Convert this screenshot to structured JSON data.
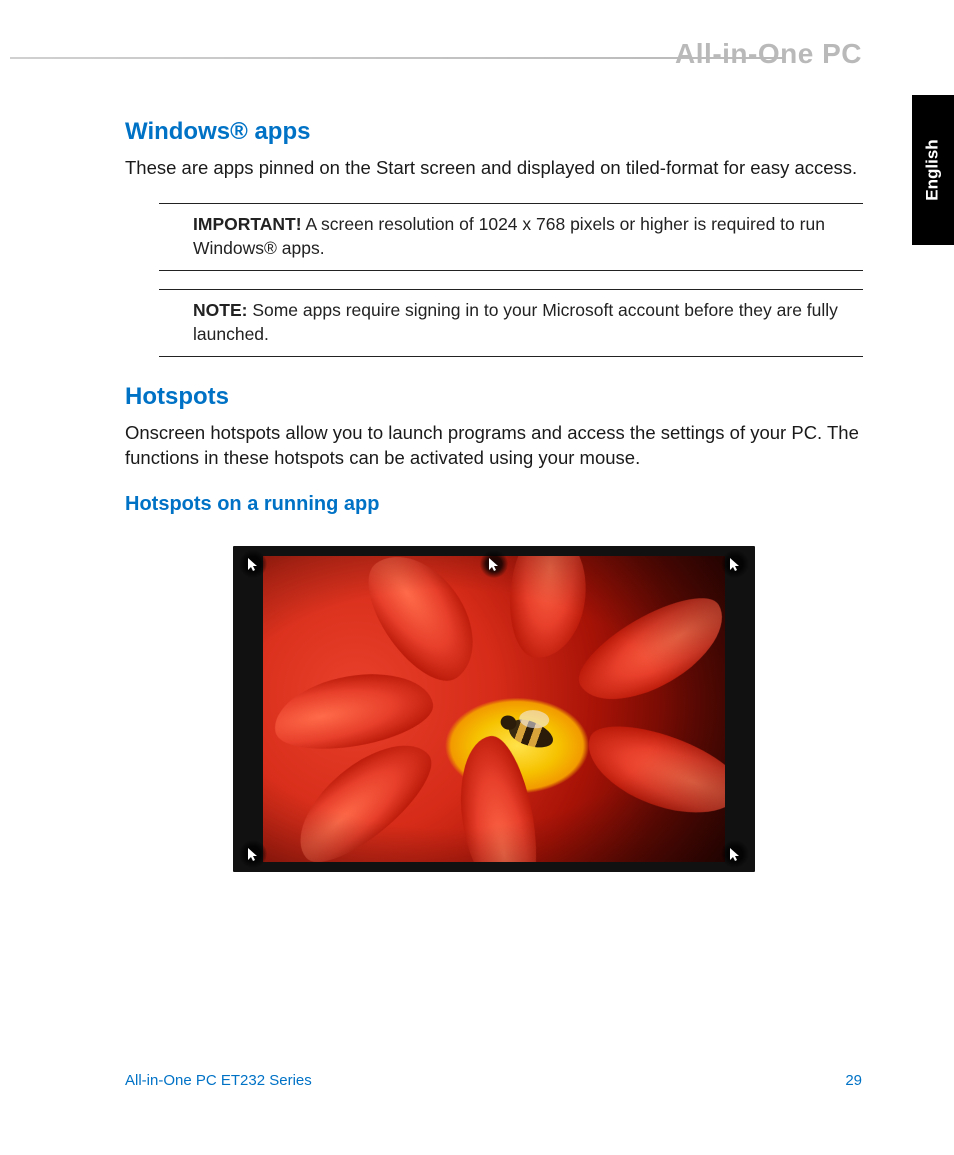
{
  "header": {
    "brand": "All-in-One PC",
    "language": "English"
  },
  "sections": {
    "apps": {
      "title": "Windows® apps",
      "body": "These are apps pinned on the Start screen and displayed on tiled-format for easy access.",
      "important_lead": "IMPORTANT!",
      "important_body": "A screen resolution of 1024 x 768 pixels or higher is required to run Windows® apps.",
      "note_lead": "NOTE:",
      "note_body": "Some apps require signing in to your Microsoft account before they are fully launched."
    },
    "hotspots": {
      "title": "Hotspots",
      "body": "Onscreen hotspots allow you to launch programs and access the settings of your PC. The functions in these hotspots can be activated using your mouse.",
      "subhead": "Hotspots on a running app"
    }
  },
  "footer": {
    "series": "All-in-One PC ET232 Series",
    "page": "29"
  }
}
